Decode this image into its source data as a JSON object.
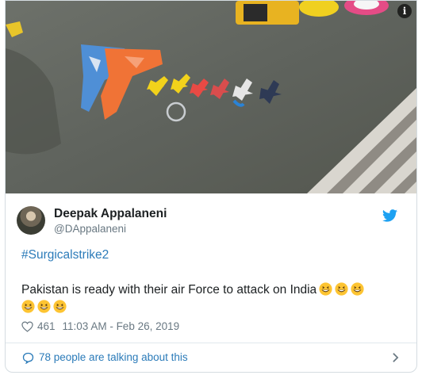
{
  "tweet": {
    "author_name": "Deepak Appalaneni",
    "author_handle": "@DAppalaneni",
    "hashtag": "#Surgicalstrike2",
    "text": "Pakistan is ready with their air Force to attack on India",
    "emoji_count": 6,
    "likes": "461",
    "timestamp": "11:03 AM - Feb 26, 2019",
    "conversation_label": "78 people are talking about this"
  },
  "icons": {
    "info": "info-icon",
    "twitter": "twitter-bird-icon",
    "like": "heart-icon",
    "conversation": "speech-bubble-icon",
    "next": "chevron-right-icon"
  },
  "colors": {
    "link": "#2b7bb9",
    "secondary_text": "#697882",
    "twitter_blue": "#1da1f2",
    "border": "#d5dce1"
  }
}
